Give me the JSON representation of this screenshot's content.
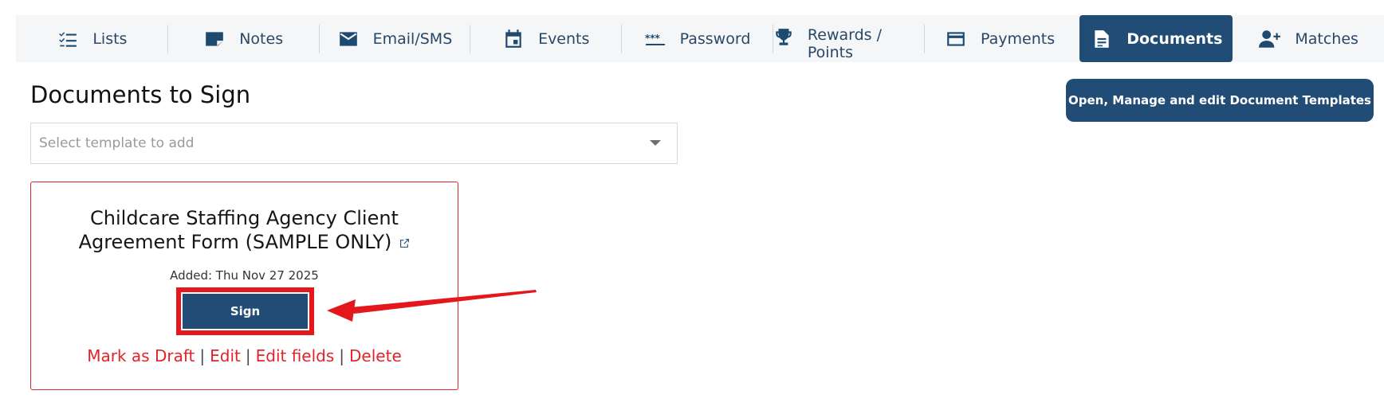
{
  "tabs": [
    {
      "label": "Lists",
      "icon": "checklist-icon"
    },
    {
      "label": "Notes",
      "icon": "note-icon"
    },
    {
      "label": "Email/SMS",
      "icon": "envelope-icon"
    },
    {
      "label": "Events",
      "icon": "calendar-icon"
    },
    {
      "label": "Password",
      "icon": "password-icon"
    },
    {
      "label": "Rewards / Points",
      "icon": "trophy-icon"
    },
    {
      "label": "Payments",
      "icon": "credit-card-icon"
    },
    {
      "label": "Documents",
      "icon": "document-icon",
      "active": true
    },
    {
      "label": "Matches",
      "icon": "add-person-icon"
    }
  ],
  "page": {
    "title": "Documents to Sign",
    "manage_button": "Open, Manage and edit Document Templates",
    "template_select": {
      "placeholder": "Select template to add"
    }
  },
  "document": {
    "title_line1": "Childcare Staffing Agency Client",
    "title_line2": "Agreement Form (SAMPLE ONLY)",
    "added": "Added: Thu Nov 27 2025",
    "sign_label": "Sign",
    "actions": {
      "mark_draft": "Mark as Draft",
      "edit": "Edit",
      "edit_fields": "Edit fields",
      "delete": "Delete",
      "separator": "|"
    }
  },
  "colors": {
    "primary": "#214c76",
    "highlight": "#e4171c",
    "link": "#e0242a"
  }
}
